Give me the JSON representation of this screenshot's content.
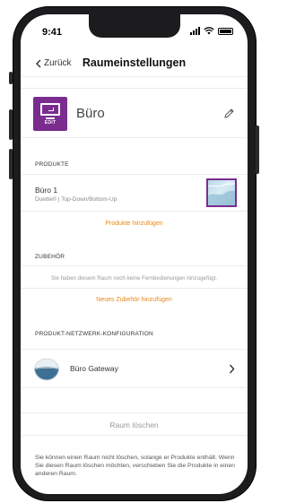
{
  "status_bar": {
    "time": "9:41"
  },
  "nav": {
    "back_label": "Zurück",
    "title": "Raumeinstellungen"
  },
  "room": {
    "name": "Büro",
    "icon_label": "EDIT",
    "icon": "monitor-icon",
    "accent_color": "#7b2c8f"
  },
  "products": {
    "header": "PRODUKTE",
    "items": [
      {
        "name": "Büro 1",
        "subtitle": "Duette® | Top-Down/Bottom-Up"
      }
    ],
    "add_label": "Produkte hinzufügen"
  },
  "accessories": {
    "header": "ZUBEHÖR",
    "empty_text": "Sie haben diesem Raum noch keine Fernbedienungen hinzugefügt.",
    "add_label": "Neues Zubehör hinzufügen"
  },
  "network": {
    "header": "PRODUKT-NETZWERK-KONFIGURATION",
    "gateway_name": "Büro Gateway"
  },
  "delete_label": "Raum löschen",
  "footer_text": "Sie können einen Raum nicht löschen, solange er Produkte enthält. Wenn Sie diesen Raum löschen möchten, verschieben Sie die Produkte in einen anderen Raum.",
  "colors": {
    "link": "#e8891a",
    "accent": "#7b2c8f"
  }
}
